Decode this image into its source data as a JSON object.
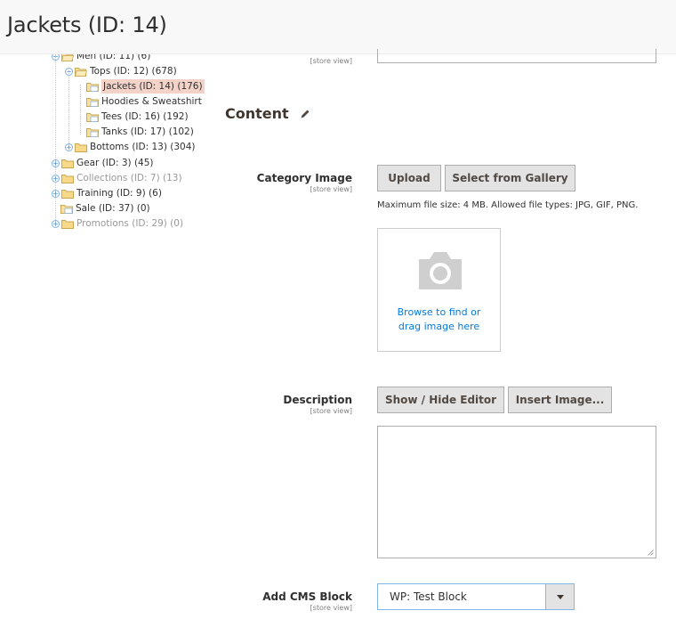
{
  "page": {
    "title": "Jackets (ID: 14)"
  },
  "tree": {
    "items": [
      {
        "label": "Men (ID: 11) (6)"
      },
      {
        "label": "Tops (ID: 12) (678)"
      },
      {
        "label": "Jackets (ID: 14) (176)"
      },
      {
        "label": "Hoodies & Sweatshirt"
      },
      {
        "label": "Tees (ID: 16) (192)"
      },
      {
        "label": "Tanks (ID: 17) (102)"
      },
      {
        "label": "Bottoms (ID: 13) (304)"
      },
      {
        "label": "Gear (ID: 3) (45)"
      },
      {
        "label": "Collections (ID: 7) (13)"
      },
      {
        "label": "Training (ID: 9) (6)"
      },
      {
        "label": "Sale (ID: 37) (0)"
      },
      {
        "label": "Promotions (ID: 29) (0)"
      }
    ]
  },
  "store_view": "[store view]",
  "content": {
    "title": "Content",
    "category_image": {
      "label": "Category Image",
      "upload_btn": "Upload",
      "gallery_btn": "Select from Gallery",
      "note": "Maximum file size: 4 MB. Allowed file types: JPG, GIF, PNG.",
      "browse_line1": "Browse to find or",
      "browse_line2": "drag image here"
    },
    "description": {
      "label": "Description",
      "toggle_btn": "Show / Hide Editor",
      "insert_btn": "Insert Image..."
    },
    "cms_block": {
      "label": "Add CMS Block",
      "selected": "WP: Test Block"
    }
  }
}
